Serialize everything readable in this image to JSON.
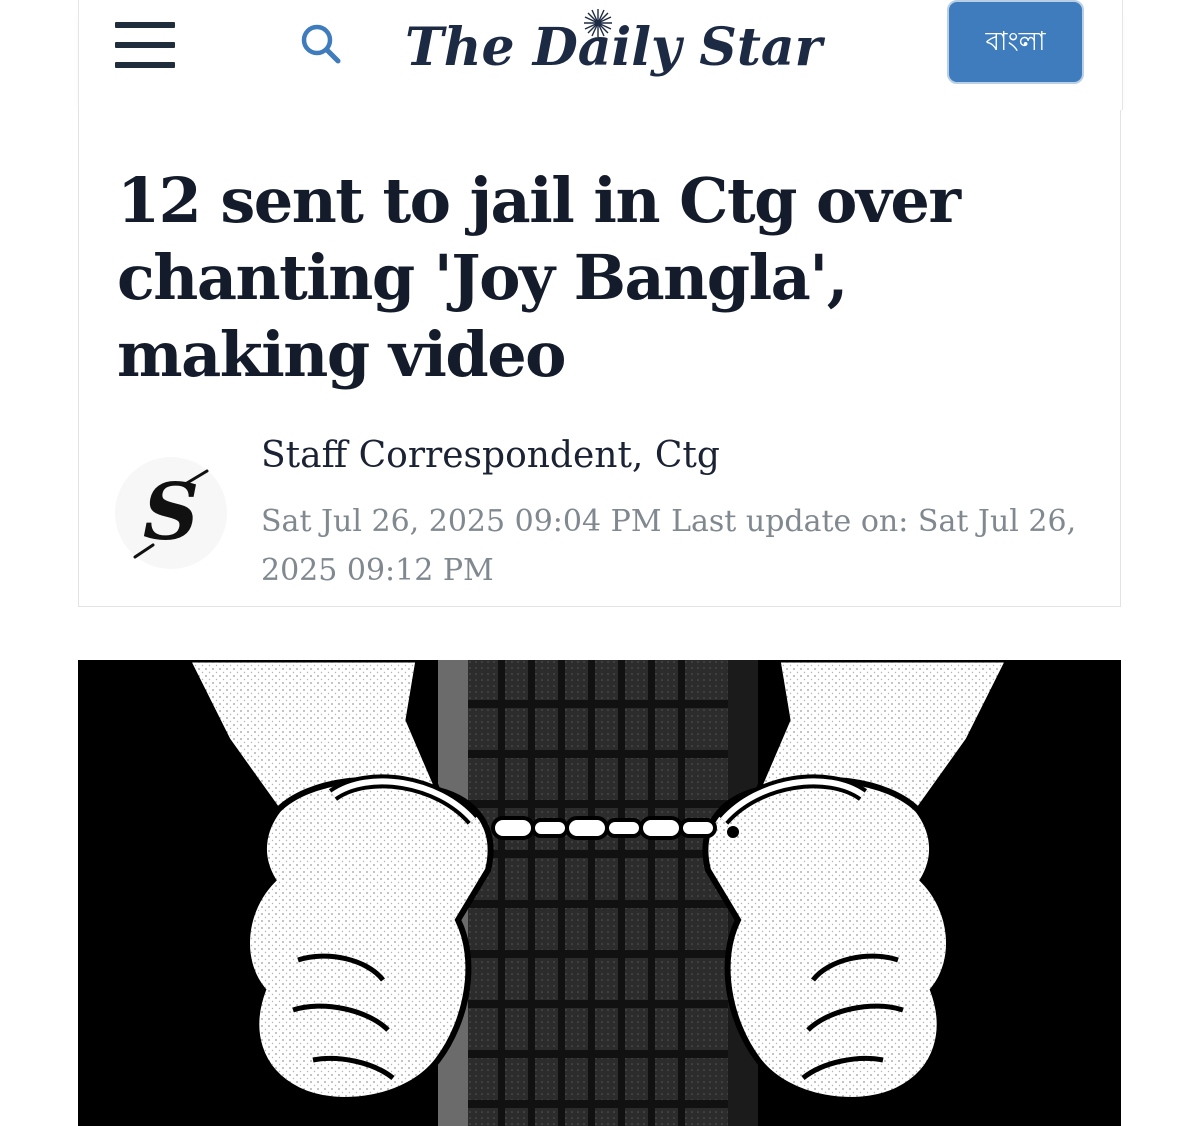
{
  "header": {
    "logo_text": "The Daily Star",
    "lang_button_label": "বাংলা",
    "brand_color": "#1c2a44",
    "accent_color": "#3f7cbd",
    "icons": [
      "menu-icon",
      "search-icon"
    ]
  },
  "article": {
    "headline": "12 sent to jail in Ctg over chanting 'Joy Bangla', making video",
    "author": "Staff Correspondent, Ctg",
    "published": "Sat Jul 26, 2025 09:04 PM",
    "updated_prefix": "Last update on:",
    "updated": "Sat Jul 26, 2025 09:12 PM",
    "avatar_letter": "S"
  }
}
